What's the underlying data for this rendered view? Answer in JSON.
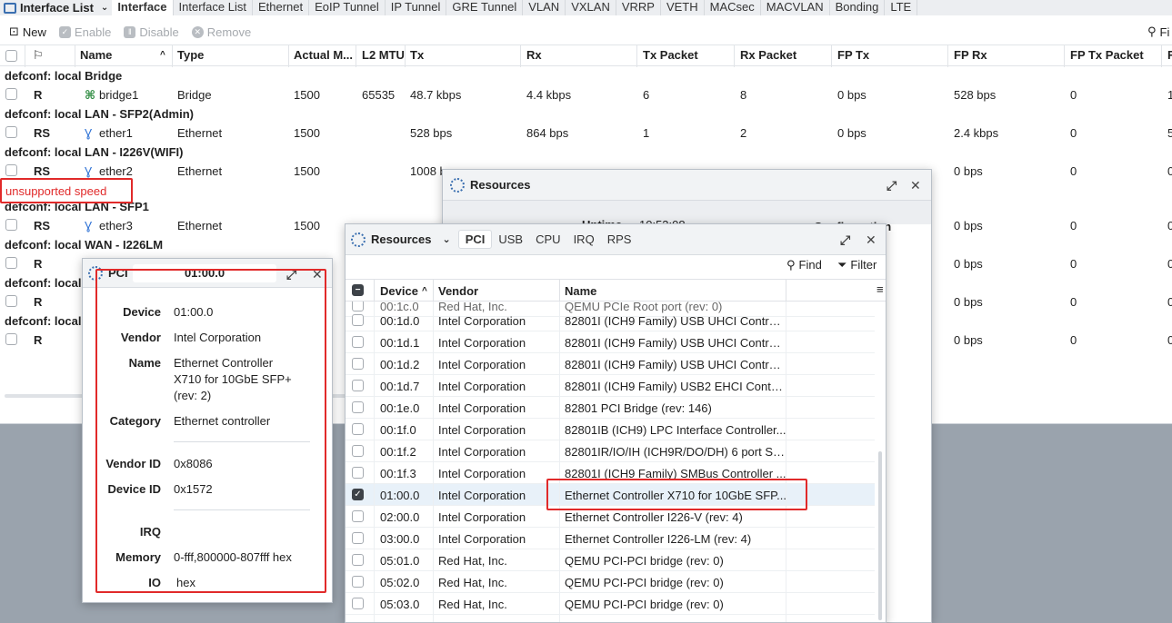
{
  "tabbar": {
    "brand_title": "Interface List",
    "tabs": [
      "Interface",
      "Interface List",
      "Ethernet",
      "EoIP Tunnel",
      "IP Tunnel",
      "GRE Tunnel",
      "VLAN",
      "VXLAN",
      "VRRP",
      "VETH",
      "MACsec",
      "MACVLAN",
      "Bonding",
      "LTE"
    ]
  },
  "toolbar": {
    "new_label": "New",
    "enable_label": "Enable",
    "disable_label": "Disable",
    "remove_label": "Remove",
    "find_label": "Fi"
  },
  "table": {
    "columns": [
      "Name",
      "Type",
      "Actual M...",
      "L2 MTU",
      "Tx",
      "Rx",
      "Tx Packet",
      "Rx Packet",
      "FP Tx",
      "FP Rx",
      "FP Tx Packet",
      "F"
    ],
    "groups": [
      {
        "comment": "defconf: local Bridge",
        "flags": "R",
        "name": "bridge1",
        "type": "Bridge",
        "mtu": "1500",
        "l2mtu": "65535",
        "tx": "48.7 kbps",
        "rx": "4.4 kbps",
        "txp": "6",
        "rxp": "8",
        "fptx": "0 bps",
        "fprx": "528 bps",
        "fptxp": "0",
        "fprxp": "1"
      },
      {
        "comment": "defconf: local LAN - SFP2(Admin)",
        "flags": "RS",
        "name": "ether1",
        "type": "Ethernet",
        "mtu": "1500",
        "l2mtu": "",
        "tx": "528 bps",
        "rx": "864 bps",
        "txp": "1",
        "rxp": "2",
        "fptx": "0 bps",
        "fprx": "2.4 kbps",
        "fptxp": "0",
        "fprxp": "5"
      },
      {
        "comment": "defconf: local LAN - I226V(WIFI)",
        "flags": "RS",
        "name": "ether2",
        "type": "Ethernet",
        "mtu": "1500",
        "l2mtu": "",
        "tx": "1008 b",
        "rx": "",
        "txp": "",
        "rxp": "",
        "fptx": "",
        "fprx": "0 bps",
        "fptxp": "0",
        "fprxp": "0"
      },
      {
        "comment": "defconf: local LAN - SFP1",
        "flags": "RS",
        "name": "ether3",
        "type": "Ethernet",
        "mtu": "1500",
        "l2mtu": "",
        "tx": "",
        "rx": "",
        "txp": "",
        "rxp": "",
        "fptx": "",
        "fprx": "0 bps",
        "fptxp": "0",
        "fprxp": "0"
      },
      {
        "comment": "defconf: local WAN - I226LM",
        "flags": "R",
        "name": "",
        "type": "",
        "mtu": "",
        "l2mtu": "",
        "tx": "",
        "rx": "",
        "txp": "",
        "rxp": "",
        "fptx": "",
        "fprx": "0 bps",
        "fptxp": "0",
        "fprxp": "0"
      },
      {
        "comment": "defconf: local",
        "flags": "R",
        "name": "",
        "type": "",
        "mtu": "",
        "l2mtu": "",
        "tx": "",
        "rx": "",
        "txp": "",
        "rxp": "",
        "fptx": "",
        "fprx": "0 bps",
        "fptxp": "0",
        "fprxp": "0"
      },
      {
        "comment": "defconf: local",
        "flags": "R",
        "name": "",
        "type": "",
        "mtu": "",
        "l2mtu": "",
        "tx": "",
        "rx": "",
        "txp": "",
        "rxp": "",
        "fptx": "",
        "fprx": "0 bps",
        "fptxp": "0",
        "fprxp": "0"
      }
    ]
  },
  "annotation": {
    "unsupported": "unsupported speed"
  },
  "resources_back": {
    "title": "Resources",
    "uptime_label": "Uptime",
    "uptime_value": "10:53:08",
    "config_label": "Configuration"
  },
  "resources": {
    "title": "Resources",
    "tabs": [
      "PCI",
      "USB",
      "CPU",
      "IRQ",
      "RPS"
    ],
    "find_label": "Find",
    "filter_label": "Filter",
    "columns": [
      "Device",
      "Vendor",
      "Name"
    ],
    "rows": [
      {
        "device": "00:1d.0",
        "vendor": "Intel Corporation",
        "name": "82801I (ICH9 Family) USB UHCI Controll...",
        "selected": false
      },
      {
        "device": "00:1d.1",
        "vendor": "Intel Corporation",
        "name": "82801I (ICH9 Family) USB UHCI Controll...",
        "selected": false
      },
      {
        "device": "00:1d.2",
        "vendor": "Intel Corporation",
        "name": "82801I (ICH9 Family) USB UHCI Controll...",
        "selected": false
      },
      {
        "device": "00:1d.7",
        "vendor": "Intel Corporation",
        "name": "82801I (ICH9 Family) USB2 EHCI Control...",
        "selected": false
      },
      {
        "device": "00:1e.0",
        "vendor": "Intel Corporation",
        "name": "82801 PCI Bridge (rev: 146)",
        "selected": false
      },
      {
        "device": "00:1f.0",
        "vendor": "Intel Corporation",
        "name": "82801IB (ICH9) LPC Interface Controller...",
        "selected": false
      },
      {
        "device": "00:1f.2",
        "vendor": "Intel Corporation",
        "name": "82801IR/IO/IH (ICH9R/DO/DH) 6 port SA...",
        "selected": false
      },
      {
        "device": "00:1f.3",
        "vendor": "Intel Corporation",
        "name": "82801I (ICH9 Family) SMBus Controller ...",
        "selected": false
      },
      {
        "device": "01:00.0",
        "vendor": "Intel Corporation",
        "name": "Ethernet Controller X710 for 10GbE SFP...",
        "selected": true
      },
      {
        "device": "02:00.0",
        "vendor": "Intel Corporation",
        "name": "Ethernet Controller I226-V (rev: 4)",
        "selected": false
      },
      {
        "device": "03:00.0",
        "vendor": "Intel Corporation",
        "name": "Ethernet Controller I226-LM (rev: 4)",
        "selected": false
      },
      {
        "device": "05:01.0",
        "vendor": "Red Hat, Inc.",
        "name": "QEMU PCI-PCI bridge (rev: 0)",
        "selected": false
      },
      {
        "device": "05:02.0",
        "vendor": "Red Hat, Inc.",
        "name": "QEMU PCI-PCI bridge (rev: 0)",
        "selected": false
      },
      {
        "device": "05:03.0",
        "vendor": "Red Hat, Inc.",
        "name": "QEMU PCI-PCI bridge (rev: 0)",
        "selected": false
      }
    ]
  },
  "pci": {
    "title": "PCI",
    "title_device": "01:00.0",
    "device_label": "Device",
    "device": "01:00.0",
    "vendor_label": "Vendor",
    "vendor": "Intel Corporation",
    "name_label": "Name",
    "name_l1": "Ethernet Controller",
    "name_l2": "X710 for 10GbE SFP+",
    "name_l3": "(rev: 2)",
    "category_label": "Category",
    "category": "Ethernet controller",
    "vendor_id_label": "Vendor ID",
    "vendor_id": "0x8086",
    "device_id_label": "Device ID",
    "device_id": "0x1572",
    "irq_label": "IRQ",
    "irq": "",
    "memory_label": "Memory",
    "memory": "0-fff,800000-807fff hex",
    "io_label": "IO",
    "io": "hex"
  }
}
